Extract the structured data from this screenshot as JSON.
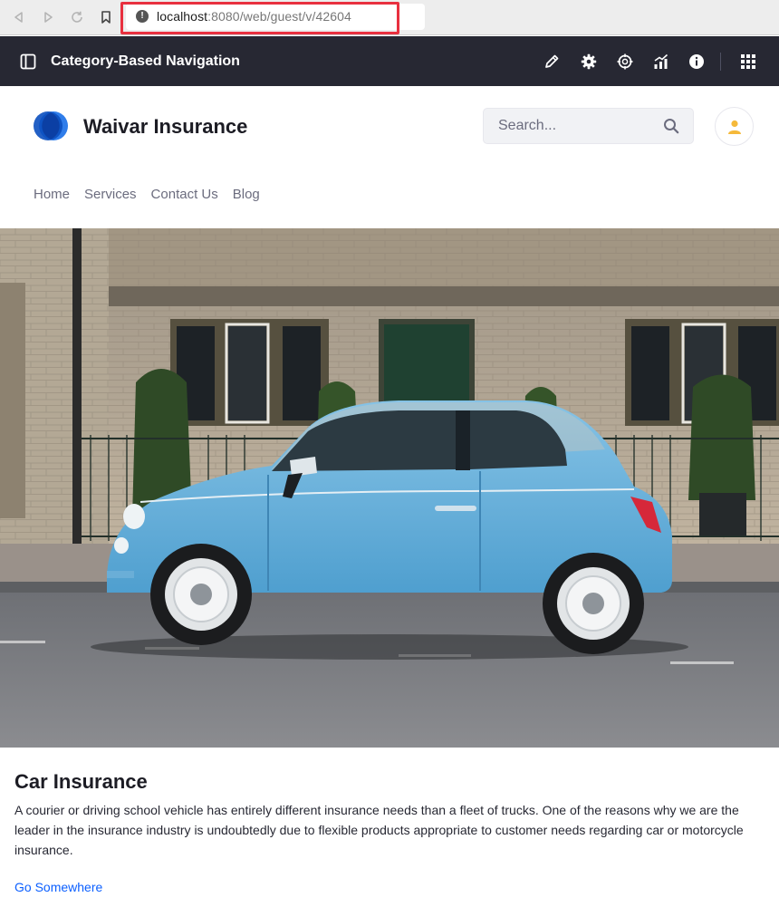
{
  "browser": {
    "url_host": "localhost",
    "url_path": ":8080/web/guest/v/42604"
  },
  "control_bar": {
    "title": "Category-Based Navigation"
  },
  "site": {
    "name": "Waivar Insurance",
    "search_placeholder": "Search...",
    "nav": [
      {
        "label": "Home"
      },
      {
        "label": "Services"
      },
      {
        "label": "Contact Us"
      },
      {
        "label": "Blog"
      }
    ]
  },
  "card": {
    "title": "Car Insurance",
    "text": "A courier or driving school vehicle has entirely different insurance needs than a fleet of trucks. One of the reasons why we are the leader in the insurance industry is undoubtedly due to flexible products appropriate to customer needs regarding car or motorcycle insurance.",
    "link": "Go Somewhere"
  },
  "colors": {
    "control_bar": "#272833",
    "link": "#0b5fff",
    "brand_blue": "#0b63ce",
    "avatar_accent": "#f5b93a"
  }
}
